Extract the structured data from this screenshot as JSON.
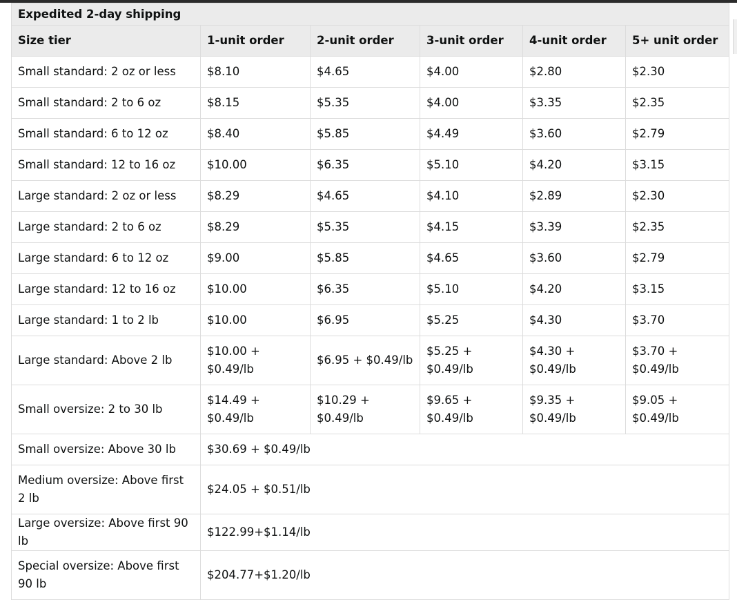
{
  "table": {
    "caption": "Expedited 2-day shipping",
    "headers": [
      "Size tier",
      "1-unit order",
      "2-unit order",
      "3-unit order",
      "4-unit order",
      "5+ unit order"
    ],
    "rows": [
      {
        "tier": "Small standard: 2 oz or less",
        "c1": "$8.10",
        "c2": "$4.65",
        "c3": "$4.00",
        "c4": "$2.80",
        "c5": "$2.30"
      },
      {
        "tier": "Small standard: 2 to 6 oz",
        "c1": "$8.15",
        "c2": "$5.35",
        "c3": "$4.00",
        "c4": "$3.35",
        "c5": "$2.35"
      },
      {
        "tier": "Small standard: 6 to 12 oz",
        "c1": "$8.40",
        "c2": "$5.85",
        "c3": "$4.49",
        "c4": "$3.60",
        "c5": "$2.79"
      },
      {
        "tier": "Small standard: 12 to 16 oz",
        "c1": "$10.00",
        "c2": "$6.35",
        "c3": "$5.10",
        "c4": "$4.20",
        "c5": "$3.15"
      },
      {
        "tier": "Large standard: 2 oz or less",
        "c1": "$8.29",
        "c2": "$4.65",
        "c3": "$4.10",
        "c4": "$2.89",
        "c5": "$2.30"
      },
      {
        "tier": "Large standard: 2 to 6 oz",
        "c1": "$8.29",
        "c2": "$5.35",
        "c3": "$4.15",
        "c4": "$3.39",
        "c5": "$2.35"
      },
      {
        "tier": "Large standard: 6 to 12 oz",
        "c1": "$9.00",
        "c2": "$5.85",
        "c3": "$4.65",
        "c4": "$3.60",
        "c5": "$2.79"
      },
      {
        "tier": "Large standard: 12 to 16 oz",
        "c1": "$10.00",
        "c2": "$6.35",
        "c3": "$5.10",
        "c4": "$4.20",
        "c5": "$3.15"
      },
      {
        "tier": "Large standard: 1 to 2 lb",
        "c1": "$10.00",
        "c2": "$6.95",
        "c3": "$5.25",
        "c4": "$4.30",
        "c5": "$3.70"
      },
      {
        "tier": "Large standard: Above 2 lb",
        "c1": "$10.00 + $0.49/lb",
        "c2": "$6.95 + $0.49/lb",
        "c3": "$5.25 + $0.49/lb",
        "c4": "$4.30 + $0.49/lb",
        "c5": "$3.70 + $0.49/lb"
      },
      {
        "tier": "Small oversize: 2 to 30 lb",
        "c1": "$14.49 + $0.49/lb",
        "c2": "$10.29 + $0.49/lb",
        "c3": "$9.65 + $0.49/lb",
        "c4": "$9.35 + $0.49/lb",
        "c5": "$9.05 + $0.49/lb"
      },
      {
        "tier": "Small oversize: Above 30 lb",
        "c1": "$30.69 + $0.49/lb"
      },
      {
        "tier": "Medium oversize: Above first 2 lb",
        "c1": "$24.05 + $0.51/lb"
      },
      {
        "tier": "Large oversize: Above first 90 lb",
        "c1": "$122.99+$1.14/lb"
      },
      {
        "tier": "Special oversize: Above first 90 lb",
        "c1": "$204.77+$1.20/lb"
      }
    ]
  }
}
